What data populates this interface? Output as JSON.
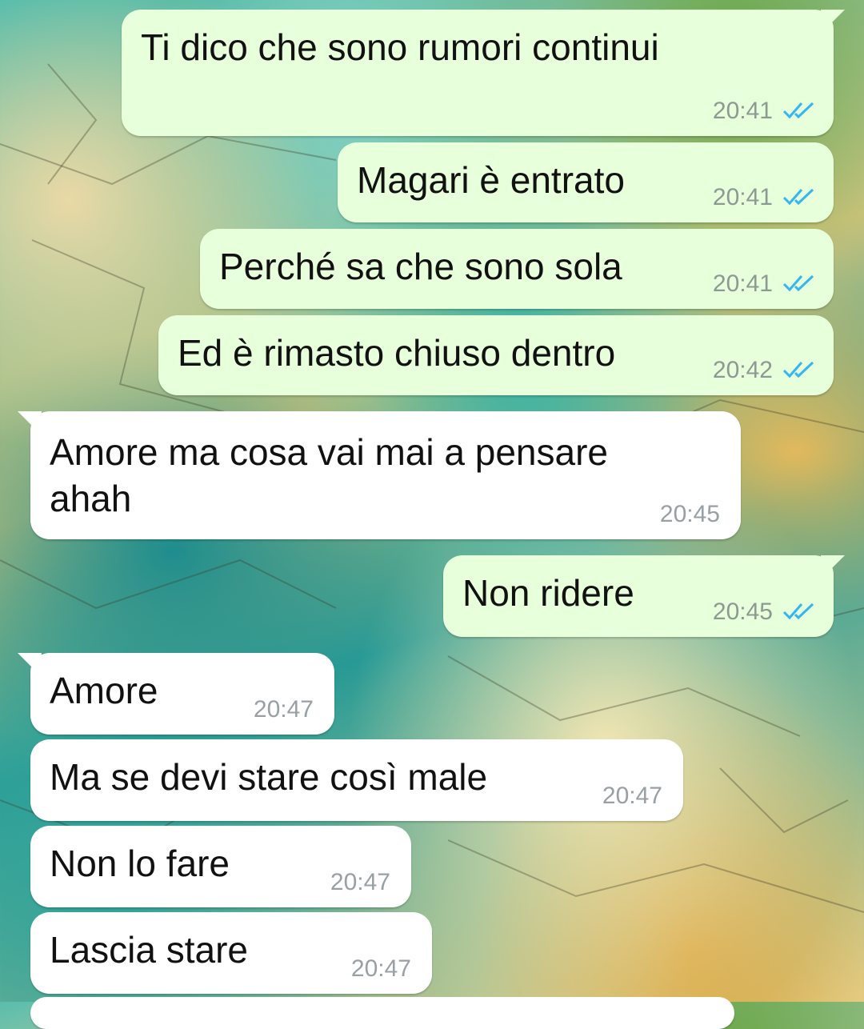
{
  "messages": [
    {
      "direction": "out",
      "text": "Ti dico che sono rumori continui",
      "time": "20:41",
      "status": "read"
    },
    {
      "direction": "out",
      "text": "Magari è entrato",
      "time": "20:41",
      "status": "read"
    },
    {
      "direction": "out",
      "text": "Perché sa che sono sola",
      "time": "20:41",
      "status": "read"
    },
    {
      "direction": "out",
      "text": "Ed è rimasto chiuso dentro",
      "time": "20:42",
      "status": "read"
    },
    {
      "direction": "in",
      "text": "Amore ma cosa vai mai a pensare\nahah",
      "time": "20:45"
    },
    {
      "direction": "out",
      "text": "Non ridere",
      "time": "20:45",
      "status": "read"
    },
    {
      "direction": "in",
      "text": "Amore",
      "time": "20:47"
    },
    {
      "direction": "in",
      "text": "Ma se devi stare così male",
      "time": "20:47"
    },
    {
      "direction": "in",
      "text": "Non lo fare",
      "time": "20:47"
    },
    {
      "direction": "in",
      "text": "Lascia stare",
      "time": "20:47"
    }
  ],
  "colors": {
    "outgoing_bubble": "#e7ffdb",
    "incoming_bubble": "#ffffff",
    "read_ticks": "#34b7f1"
  },
  "icons": {
    "read_receipt": "double-check-icon"
  }
}
